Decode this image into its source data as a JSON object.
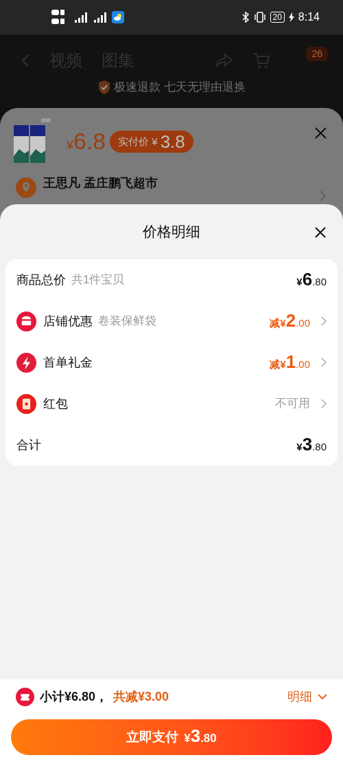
{
  "status_bar": {
    "time": "8:14",
    "battery": "20"
  },
  "background_page": {
    "tabs": [
      "视频",
      "图集"
    ],
    "cart_badge": "26",
    "guarantee": "极速退款 七天无理由退换"
  },
  "product_sheet": {
    "price_currency": "¥",
    "price": "6.8",
    "actual_price_label": "实付价",
    "actual_price_currency": "¥",
    "actual_price": "3.8",
    "address_name": "王思凡 孟庄鹏飞超市"
  },
  "price_detail": {
    "title": "价格明细",
    "rows": [
      {
        "kind": "subtotal",
        "label": "商品总价",
        "note": "共1件宝贝",
        "prefix": "¥",
        "integer": "6",
        "decimal": ".80"
      },
      {
        "kind": "shop",
        "label": "店铺优惠",
        "note": "卷装保鲜袋",
        "prefix": "减¥",
        "integer": "2",
        "decimal": ".00"
      },
      {
        "kind": "gift",
        "label": "首单礼金",
        "prefix": "减¥",
        "integer": "1",
        "decimal": ".00"
      },
      {
        "kind": "packet",
        "label": "红包",
        "text": "不可用"
      },
      {
        "kind": "total",
        "label": "合计",
        "prefix": "¥",
        "integer": "3",
        "decimal": ".80"
      }
    ]
  },
  "footer": {
    "subtotal": "小计¥6.80，",
    "discount_total": "共减¥3.00",
    "detail_toggle": "明细",
    "expanded": true,
    "pay_button": {
      "label": "立即支付",
      "prefix": "¥",
      "integer": "3",
      "decimal": ".80"
    }
  }
}
